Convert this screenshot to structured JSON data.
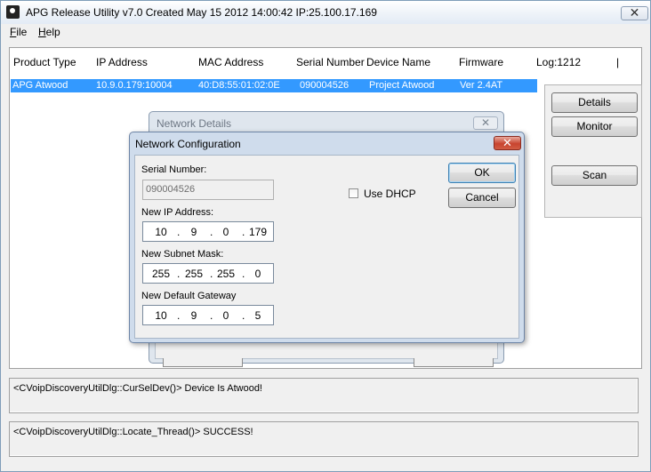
{
  "window": {
    "title": "APG Release Utility v7.0 Created May 15 2012 14:00:42  IP:25.100.17.169",
    "close_symbol": "✕"
  },
  "menu": [
    {
      "label": "File",
      "accel": "F",
      "rest": "ile"
    },
    {
      "label": "Help",
      "accel": "H",
      "rest": "elp"
    }
  ],
  "list": {
    "columns": [
      "Product Type",
      "IP Address",
      "MAC Address",
      "Serial Number",
      "Device Name",
      "Firmware",
      "Log:1212",
      "|"
    ],
    "rows": [
      {
        "product_type": "APG Atwood",
        "ip_address": "10.9.0.179:10004",
        "mac_address": "40:D8:55:01:02:0E",
        "serial_number": "090004526",
        "device_name": "Project Atwood",
        "firmware": "Ver 2.4AT"
      }
    ]
  },
  "side_buttons": {
    "details": "Details",
    "monitor": "Monitor",
    "scan": "Scan"
  },
  "log": [
    "<CVoipDiscoveryUtilDlg::CurSelDev()> Device Is Atwood!",
    "<CVoipDiscoveryUtilDlg::Locate_Thread()> SUCCESS!"
  ],
  "network_details": {
    "title": "Network Details",
    "close_symbol": "✕"
  },
  "network_config": {
    "title": "Network Configuration",
    "close_symbol": "✕",
    "serial_label": "Serial Number:",
    "serial_value": "090004526",
    "ip_label": "New IP Address:",
    "ip_octets": [
      "10",
      "9",
      "0",
      "179"
    ],
    "subnet_label": "New Subnet Mask:",
    "subnet_octets": [
      "255",
      "255",
      "255",
      "0"
    ],
    "gateway_label": "New Default Gateway",
    "gateway_octets": [
      "10",
      "9",
      "0",
      "5"
    ],
    "dot": ".",
    "dhcp_label": "Use DHCP",
    "dhcp_checked": false,
    "ok_label": "OK",
    "cancel_label": "Cancel"
  }
}
